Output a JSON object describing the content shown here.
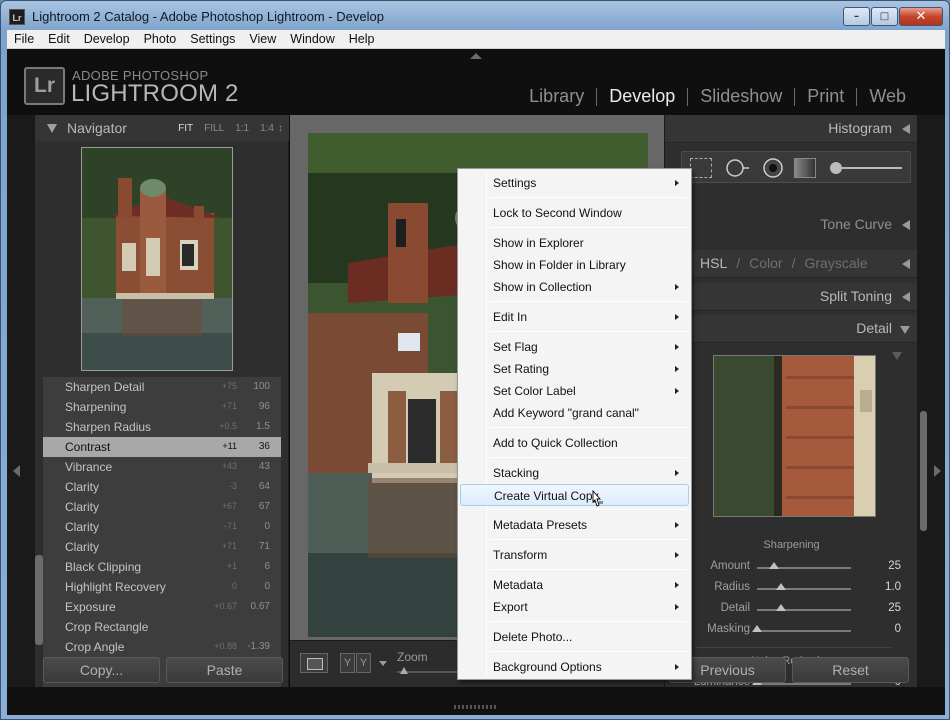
{
  "window": {
    "title": "Lightroom 2 Catalog - Adobe Photoshop Lightroom - Develop",
    "icon_text": "Lr",
    "controls": [
      "minimize-icon",
      "maximize-icon",
      "close-icon"
    ]
  },
  "menubar": [
    "File",
    "Edit",
    "Develop",
    "Photo",
    "Settings",
    "View",
    "Window",
    "Help"
  ],
  "brand": {
    "logo": "Lr",
    "line1": "ADOBE PHOTOSHOP",
    "line2": "LIGHTROOM 2"
  },
  "modules": [
    {
      "label": "Library",
      "active": false
    },
    {
      "label": "Develop",
      "active": true
    },
    {
      "label": "Slideshow",
      "active": false
    },
    {
      "label": "Print",
      "active": false
    },
    {
      "label": "Web",
      "active": false
    }
  ],
  "navigator": {
    "title": "Navigator",
    "zoom_options": [
      "FIT",
      "FILL",
      "1:1",
      "1:4"
    ],
    "zoom_active": "FIT"
  },
  "history": [
    {
      "name": "Sharpen Detail",
      "delta": "+75",
      "value": "100",
      "selected": false
    },
    {
      "name": "Sharpening",
      "delta": "+71",
      "value": "96",
      "selected": false
    },
    {
      "name": "Sharpen Radius",
      "delta": "+0.5",
      "value": "1.5",
      "selected": false
    },
    {
      "name": "Contrast",
      "delta": "+11",
      "value": "36",
      "selected": true
    },
    {
      "name": "Vibrance",
      "delta": "+43",
      "value": "43",
      "selected": false
    },
    {
      "name": "Clarity",
      "delta": "-3",
      "value": "64",
      "selected": false
    },
    {
      "name": "Clarity",
      "delta": "+67",
      "value": "67",
      "selected": false
    },
    {
      "name": "Clarity",
      "delta": "-71",
      "value": "0",
      "selected": false
    },
    {
      "name": "Clarity",
      "delta": "+71",
      "value": "71",
      "selected": false
    },
    {
      "name": "Black Clipping",
      "delta": "+1",
      "value": "6",
      "selected": false
    },
    {
      "name": "Highlight Recovery",
      "delta": "0",
      "value": "0",
      "selected": false
    },
    {
      "name": "Exposure",
      "delta": "+0.67",
      "value": "0.67",
      "selected": false
    },
    {
      "name": "Crop Rectangle",
      "delta": "",
      "value": "",
      "selected": false
    },
    {
      "name": "Crop Angle",
      "delta": "+0.88",
      "value": "-1.39",
      "selected": false
    }
  ],
  "left_buttons": {
    "copy": "Copy...",
    "paste": "Paste"
  },
  "toolbar": {
    "yy": [
      "Y",
      "Y"
    ],
    "zoom_label": "Zoom"
  },
  "right_panel": {
    "histogram": "Histogram",
    "tone_curve": "Tone Curve",
    "hsl_tabs": [
      "HSL",
      "Color",
      "Grayscale"
    ],
    "hsl_sep": "/",
    "split_toning": "Split Toning",
    "detail": "Detail",
    "sharpening_label": "Sharpening",
    "sharpening": [
      {
        "name": "Amount",
        "value": "25",
        "pos": 0.18
      },
      {
        "name": "Radius",
        "value": "1.0",
        "pos": 0.25
      },
      {
        "name": "Detail",
        "value": "25",
        "pos": 0.25
      },
      {
        "name": "Masking",
        "value": "0",
        "pos": 0.0
      }
    ],
    "noise_label": "Noise Reduction",
    "noise": [
      {
        "name": "Luminance",
        "value": "0",
        "pos": 0.0
      }
    ]
  },
  "right_buttons": {
    "previous": "Previous",
    "reset": "Reset"
  },
  "context_menu": {
    "items": [
      {
        "label": "Settings",
        "submenu": true
      },
      {
        "sep": true
      },
      {
        "label": "Lock to Second Window",
        "submenu": false
      },
      {
        "sep": true
      },
      {
        "label": "Show in Explorer",
        "submenu": false
      },
      {
        "label": "Show in Folder in Library",
        "submenu": false
      },
      {
        "label": "Show in Collection",
        "submenu": true
      },
      {
        "sep": true
      },
      {
        "label": "Edit In",
        "submenu": true
      },
      {
        "sep": true
      },
      {
        "label": "Set Flag",
        "submenu": true
      },
      {
        "label": "Set Rating",
        "submenu": true
      },
      {
        "label": "Set Color Label",
        "submenu": true
      },
      {
        "label": "Add Keyword \"grand canal\"",
        "submenu": false
      },
      {
        "sep": true
      },
      {
        "label": "Add to Quick Collection",
        "submenu": false
      },
      {
        "sep": true
      },
      {
        "label": "Stacking",
        "submenu": true
      },
      {
        "label": "Create Virtual Copy",
        "submenu": false,
        "highlighted": true
      },
      {
        "sep": true
      },
      {
        "label": "Metadata Presets",
        "submenu": true
      },
      {
        "sep": true
      },
      {
        "label": "Transform",
        "submenu": true
      },
      {
        "sep": true
      },
      {
        "label": "Metadata",
        "submenu": true
      },
      {
        "label": "Export",
        "submenu": true
      },
      {
        "sep": true
      },
      {
        "label": "Delete Photo...",
        "submenu": false
      },
      {
        "sep": true
      },
      {
        "label": "Background Options",
        "submenu": true
      }
    ]
  },
  "colors": {
    "panel_bg": "#2e2e2e",
    "app_bg": "#0f0f0f",
    "menu_highlight": "#dcebfc",
    "selected_history": "#a8a8a8"
  }
}
